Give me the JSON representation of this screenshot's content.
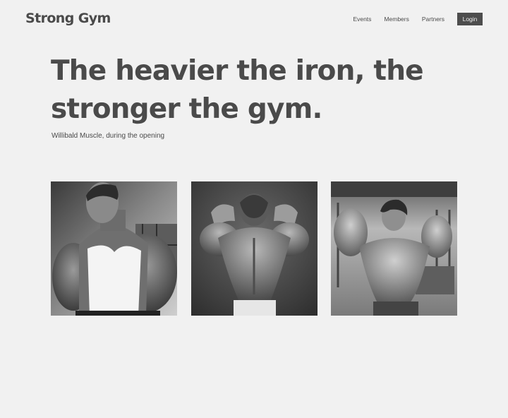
{
  "header": {
    "brand": "Strong Gym",
    "nav": [
      {
        "label": "Events"
      },
      {
        "label": "Members"
      },
      {
        "label": "Partners"
      }
    ],
    "login_label": "Login"
  },
  "hero": {
    "title_line1": "The heavier the iron, the",
    "title_line2": "stronger the gym.",
    "caption": "Willibald Muscle, during the opening"
  },
  "gallery": {
    "photos": [
      {
        "subject": "bodybuilder-front-tanktop"
      },
      {
        "subject": "bodybuilder-back-double-biceps"
      },
      {
        "subject": "bodybuilder-front-double-biceps"
      }
    ]
  },
  "colors": {
    "background": "#f1f1f1",
    "text": "#4a4a4a",
    "button": "#4d4d4d"
  }
}
